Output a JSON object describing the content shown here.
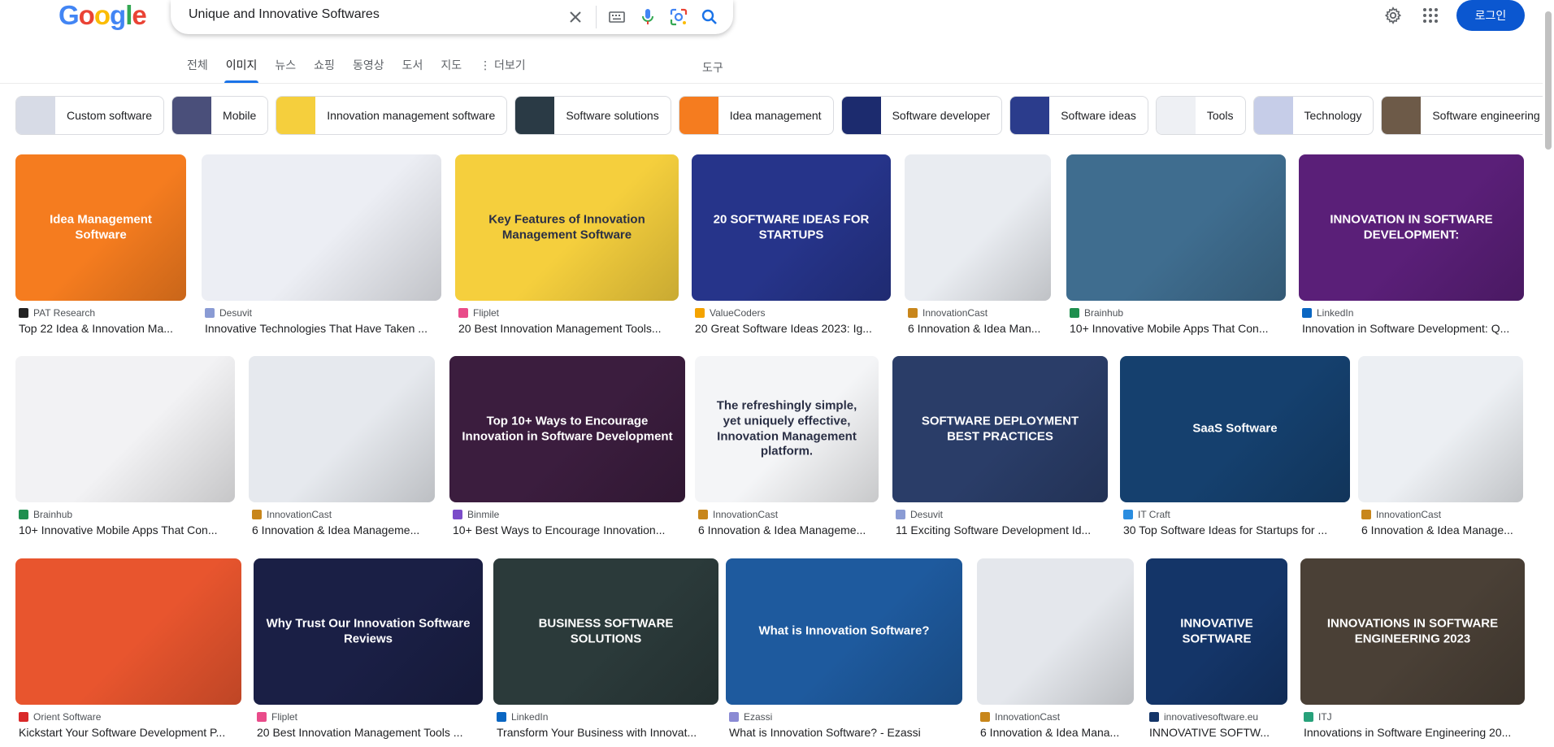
{
  "logo": [
    "G",
    "o",
    "o",
    "g",
    "l",
    "e"
  ],
  "logo_colors": [
    "#4285F4",
    "#EA4335",
    "#FBBC05",
    "#4285F4",
    "#34A853",
    "#EA4335"
  ],
  "search": {
    "query": "Unique and Innovative Softwares"
  },
  "header": {
    "login_label": "로그인"
  },
  "tabs": [
    "전체",
    "이미지",
    "뉴스",
    "쇼핑",
    "동영상",
    "도서",
    "지도",
    "⋮ 더보기"
  ],
  "tools_label": "도구",
  "chips": [
    {
      "label": "Custom software",
      "color": "#d7dbe6"
    },
    {
      "label": "Mobile",
      "color": "#4a4f7a"
    },
    {
      "label": "Innovation management software",
      "color": "#f5cf3d"
    },
    {
      "label": "Software solutions",
      "color": "#2a3a45"
    },
    {
      "label": "Idea management",
      "color": "#f57c1f"
    },
    {
      "label": "Software developer",
      "color": "#1c2b6e"
    },
    {
      "label": "Software ideas",
      "color": "#2b3c8c"
    },
    {
      "label": "Tools",
      "color": "#eef0f4"
    },
    {
      "label": "Technology",
      "color": "#c6cde8"
    },
    {
      "label": "Software engineering",
      "color": "#6d5a48"
    }
  ],
  "results": [
    {
      "source": "PAT Research",
      "title": "Top 22 Idea & Innovation Ma...",
      "color": "#f57c1f",
      "fav": "#222222"
    },
    {
      "source": "Desuvit",
      "title": "Innovative Technologies That Have Taken ...",
      "color": "#eceef4",
      "fav": "#8a9bd4"
    },
    {
      "source": "Fliplet",
      "title": "20 Best Innovation Management Tools...",
      "color": "#f5cf3d",
      "fav": "#e94b8a"
    },
    {
      "source": "ValueCoders",
      "title": "20 Great Software Ideas 2023: Ig...",
      "color": "#26348a",
      "fav": "#f4a300"
    },
    {
      "source": "InnovationCast",
      "title": "6 Innovation & Idea Man...",
      "color": "#e9ecf1",
      "fav": "#c8861b"
    },
    {
      "source": "Brainhub",
      "title": "10+ Innovative Mobile Apps That Con...",
      "color": "#3f6d8f",
      "fav": "#1e8f4e"
    },
    {
      "source": "LinkedIn",
      "title": "Innovation in Software Development: Q...",
      "color": "#5a1f78",
      "fav": "#0a66c2"
    },
    {
      "source": "Brainhub",
      "title": "10+ Innovative Mobile Apps That Con...",
      "color": "#f2f2f4",
      "fav": "#1e8f4e"
    },
    {
      "source": "InnovationCast",
      "title": "6 Innovation & Idea Manageme...",
      "color": "#e6e9ee",
      "fav": "#c8861b"
    },
    {
      "source": "Binmile",
      "title": "10+ Best Ways to Encourage Innovation...",
      "color": "#3b1d3e",
      "fav": "#7b4cc9"
    },
    {
      "source": "InnovationCast",
      "title": "6 Innovation & Idea Manageme...",
      "color": "#f4f5f7",
      "fav": "#c8861b"
    },
    {
      "source": "Desuvit",
      "title": "11 Exciting Software Development Id...",
      "color": "#2a3d68",
      "fav": "#8a9bd4"
    },
    {
      "source": "IT Craft",
      "title": "30 Top Software Ideas for Startups for ...",
      "color": "#15406e",
      "fav": "#2a8de0"
    },
    {
      "source": "InnovationCast",
      "title": "6 Innovation & Idea Manage...",
      "color": "#eceff3",
      "fav": "#c8861b"
    },
    {
      "source": "Orient Software",
      "title": "Kickstart Your Software Development P...",
      "color": "#e8552e",
      "fav": "#d92828"
    },
    {
      "source": "Fliplet",
      "title": "20 Best Innovation Management Tools ...",
      "color": "#1a1f45",
      "fav": "#e94b8a"
    },
    {
      "source": "LinkedIn",
      "title": "Transform Your Business with Innovat...",
      "color": "#2b3a3a",
      "fav": "#0a66c2"
    },
    {
      "source": "Ezassi",
      "title": "What is Innovation Software? - Ezassi",
      "color": "#1e5a9e",
      "fav": "#8a8ad4"
    },
    {
      "source": "InnovationCast",
      "title": "6 Innovation & Idea Mana...",
      "color": "#e4e7ec",
      "fav": "#c8861b"
    },
    {
      "source": "innovativesoftware.eu",
      "title": "INNOVATIVE SOFTW...",
      "color": "#143568",
      "fav": "#143568"
    },
    {
      "source": "ITJ",
      "title": "Innovations in Software Engineering 20...",
      "color": "#4a4036",
      "fav": "#27a17a"
    }
  ],
  "image_texts": {
    "r1": "Idea Management Software",
    "r3": "Key Features of Innovation Management Software",
    "r4": "20 SOFTWARE IDEAS FOR STARTUPS",
    "r7": "INNOVATION IN SOFTWARE DEVELOPMENT:",
    "r10": "Top 10+ Ways to Encourage Innovation in Software Development",
    "r11": "The refreshingly simple, yet uniquely effective, Innovation Management platform.",
    "r12": "SOFTWARE DEPLOYMENT BEST PRACTICES",
    "r13": "SaaS Software",
    "r16": "Why Trust Our Innovation Software Reviews",
    "r17": "BUSINESS SOFTWARE SOLUTIONS",
    "r18": "What is Innovation Software?",
    "r20": "INNOVATIVE SOFTWARE",
    "r21": "INNOVATIONS IN SOFTWARE ENGINEERING 2023"
  }
}
